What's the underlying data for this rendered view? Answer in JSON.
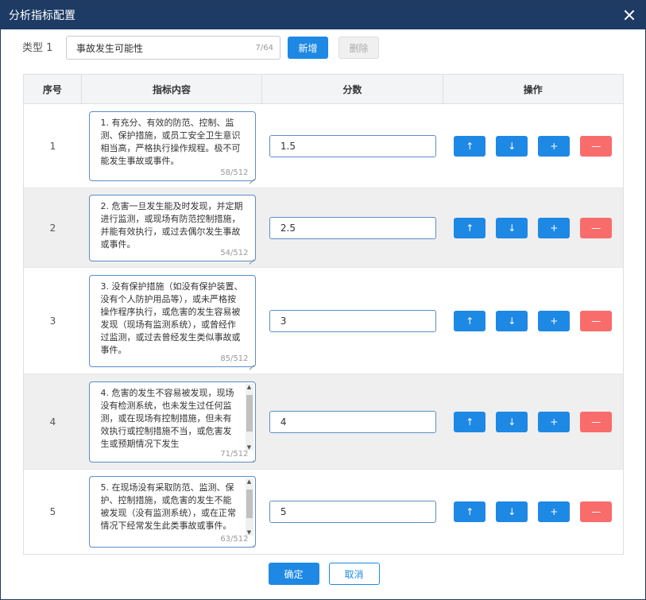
{
  "dialog": {
    "title": "分析指标配置"
  },
  "type_row": {
    "label": "类型 1",
    "input_value": "事故发生可能性",
    "char_count": "7/64",
    "add_label": "新增",
    "delete_label": "删除"
  },
  "table": {
    "headers": [
      "序号",
      "指标内容",
      "分数",
      "操作"
    ],
    "rows": [
      {
        "index": "1",
        "content": "1. 有充分、有效的防范、控制、监测、保护措施，或员工安全卫生意识相当高，严格执行操作规程。极不可能发生事故或事件。",
        "count": "58/512",
        "score": "1.5"
      },
      {
        "index": "2",
        "content": "2. 危害一旦发生能及时发现，并定期进行监测，或现场有防范控制措施，并能有效执行，或过去偶尔发生事故或事件。",
        "count": "54/512",
        "score": "2.5"
      },
      {
        "index": "3",
        "content": "3. 没有保护措施（如没有保护装置、没有个人防护用品等），或未严格按操作程序执行，或危害的发生容易被发现（现场有监测系统），或曾经作过监测，或过去曾经发生类似事故或事件。",
        "count": "85/512",
        "score": "3"
      },
      {
        "index": "4",
        "content": "4. 危害的发生不容易被发现，现场没有检测系统，也未发生过任何监测，或在现场有控制措施，但未有效执行或控制措施不当，或危害发生或预期情况下发生",
        "count": "71/512",
        "score": "4"
      },
      {
        "index": "5",
        "content": "5. 在现场没有采取防范、监测、保护、控制措施，或危害的发生不能被发现（没有监测系统），或在正常情况下经常发生此类事故或事件。",
        "count": "63/512",
        "score": "5"
      }
    ],
    "ops": {
      "up": "↑",
      "down": "↓",
      "add": "+",
      "remove": "—"
    }
  },
  "footer": {
    "ok_label": "确定",
    "cancel_label": "取消"
  },
  "colors": {
    "titlebar": "#1d3b64",
    "primary": "#1e88e5",
    "danger": "#f86c6b",
    "header_bg": "#f3f4f6"
  }
}
